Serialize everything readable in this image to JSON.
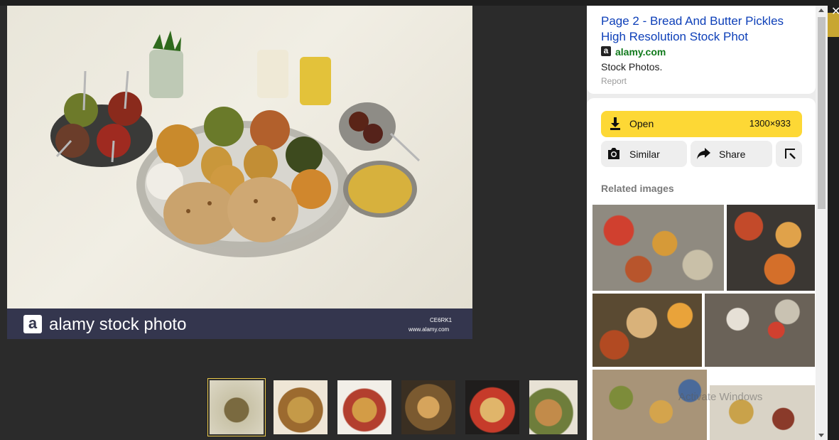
{
  "main_image": {
    "watermark": {
      "logo_letter": "a",
      "brand_text": "alamy stock photo",
      "code": "CE6RK1",
      "url": "www.alamy.com"
    }
  },
  "thumbnails": {
    "count": 6,
    "selected_index": 0
  },
  "panel": {
    "title": "Page 2 - Bread And Butter Pickles High Resolution Stock Phot",
    "source": {
      "logo_letter": "a",
      "name": "alamy.com"
    },
    "description": "Stock Photos.",
    "report_label": "Report",
    "open_button": {
      "label": "Open",
      "size": "1300×933"
    },
    "similar_button": {
      "label": "Similar"
    },
    "share_button": {
      "label": "Share"
    },
    "related_title": "Related images"
  },
  "overlay": {
    "activate_text": "Activate Windows",
    "close_icon": "close-icon"
  },
  "colors": {
    "accent_yellow": "#fdd835",
    "title_blue": "#0d3fb8",
    "source_green": "#117a1c",
    "watermark_bar": "#34364e"
  }
}
